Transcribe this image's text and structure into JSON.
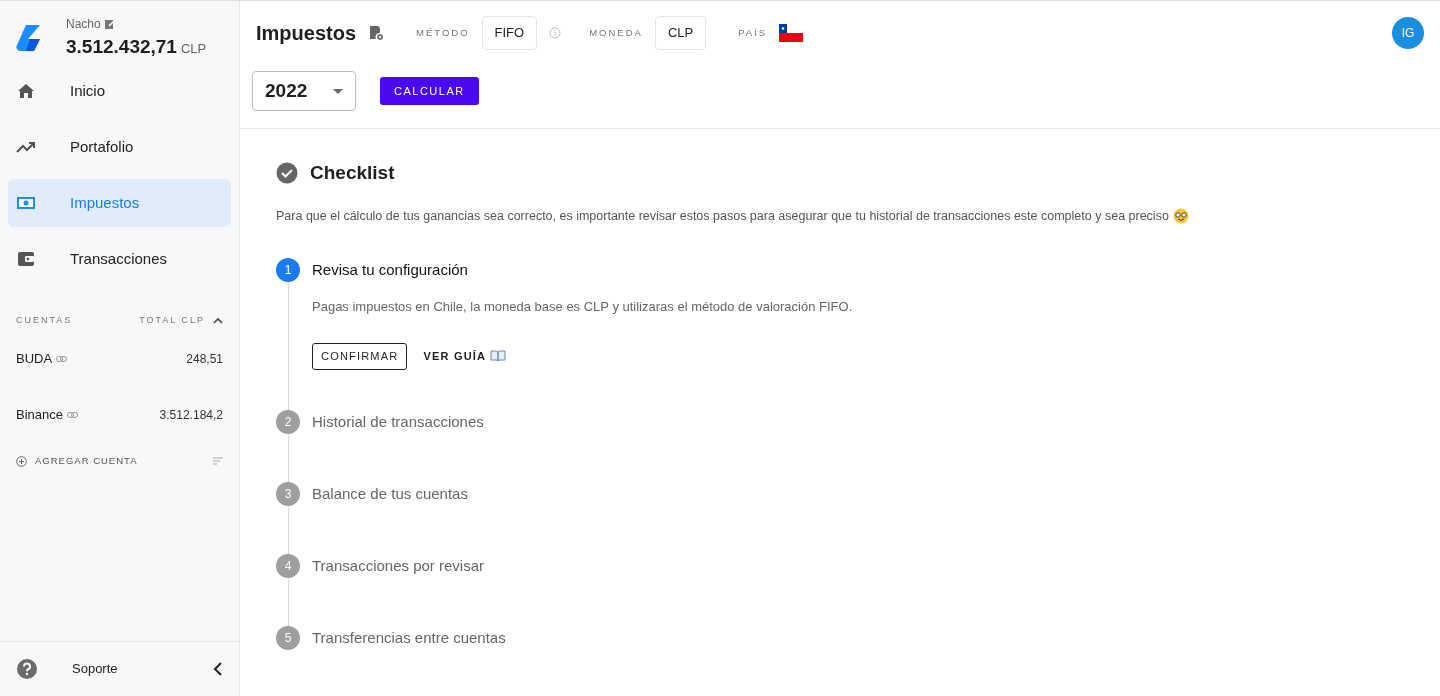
{
  "user": {
    "name": "Nacho",
    "balance": "3.512.432,71",
    "currency": "CLP"
  },
  "nav": [
    {
      "label": "Inicio",
      "kind": "home",
      "selected": false
    },
    {
      "label": "Portafolio",
      "kind": "trend",
      "selected": false
    },
    {
      "label": "Impuestos",
      "kind": "money",
      "selected": true
    },
    {
      "label": "Transacciones",
      "kind": "wallet",
      "selected": false
    }
  ],
  "accounts": {
    "heading": "CUENTAS",
    "total_heading": "TOTAL CLP",
    "expanded": true,
    "items": [
      {
        "name": "BUDA",
        "total": "248,51"
      },
      {
        "name": "Binance",
        "total": "3.512.184,2"
      }
    ],
    "add_label": "AGREGAR CUENTA"
  },
  "support": {
    "label": "Soporte"
  },
  "header": {
    "title": "Impuestos",
    "method_label": "MÉTODO",
    "method": "FIFO",
    "currency_label": "MONEDA",
    "currency": "CLP",
    "country_label": "PAÍS",
    "avatar": "IG"
  },
  "year": {
    "value": "2022"
  },
  "calculate_button": "CALCULAR",
  "checklist": {
    "title": "Checklist",
    "intro": "Para que el cálculo de tus ganancias sea correcto, es importante revisar estos pasos para asegurar que tu historial de transacciones este completo y sea preciso",
    "steps": [
      {
        "number": "1",
        "title": "Revisa tu configuración",
        "active": true,
        "description": "Pagas impuestos en Chile, la moneda base es CLP y utilizaras el método de valoración FIFO.",
        "confirm": "CONFIRMAR",
        "guide": "VER GUÍA"
      },
      {
        "number": "2",
        "title": "Historial de transacciones",
        "active": false
      },
      {
        "number": "3",
        "title": "Balance de tus cuentas",
        "active": false
      },
      {
        "number": "4",
        "title": "Transacciones por revisar",
        "active": false
      },
      {
        "number": "5",
        "title": "Transferencias entre cuentas",
        "active": false
      }
    ]
  }
}
